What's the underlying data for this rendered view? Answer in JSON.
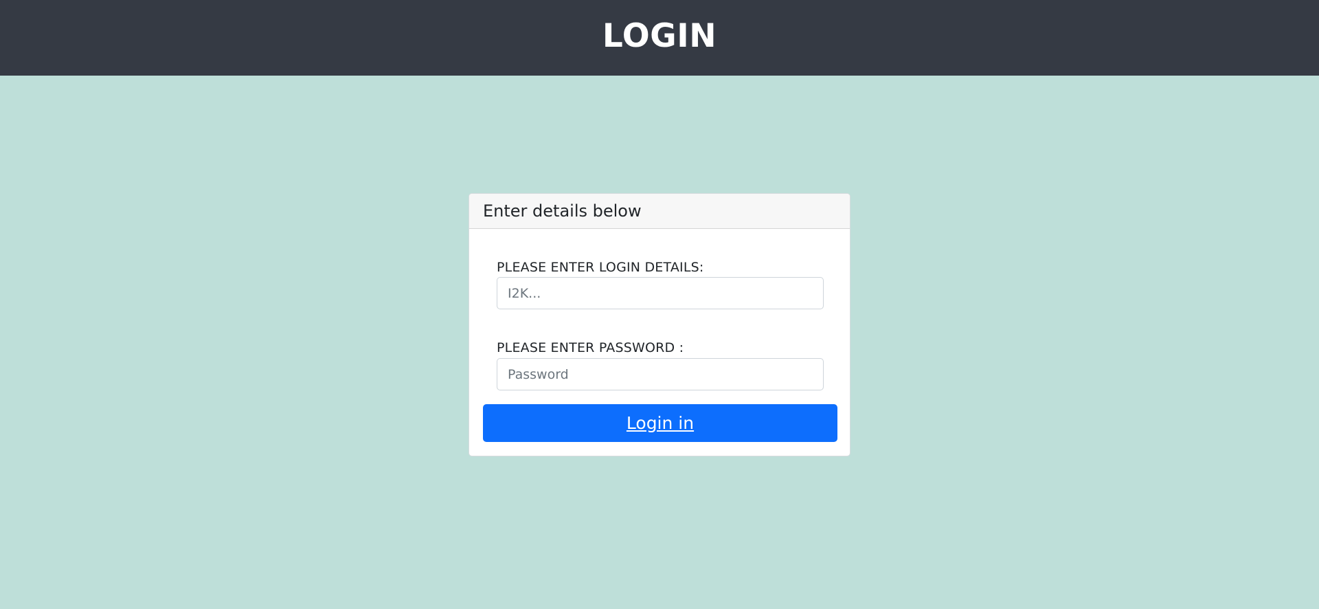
{
  "header": {
    "title": "LOGIN"
  },
  "card": {
    "title": "Enter details below",
    "login": {
      "label": "PLEASE ENTER LOGIN DETAILS:",
      "placeholder": "I2K...",
      "value": ""
    },
    "password": {
      "label": "PLEASE ENTER PASSWORD :",
      "placeholder": "Password",
      "value": ""
    },
    "submit_label": "Login in"
  },
  "colors": {
    "page_background": "#bedfd9",
    "header_background": "#353a44",
    "button_primary": "#0d6efd"
  }
}
